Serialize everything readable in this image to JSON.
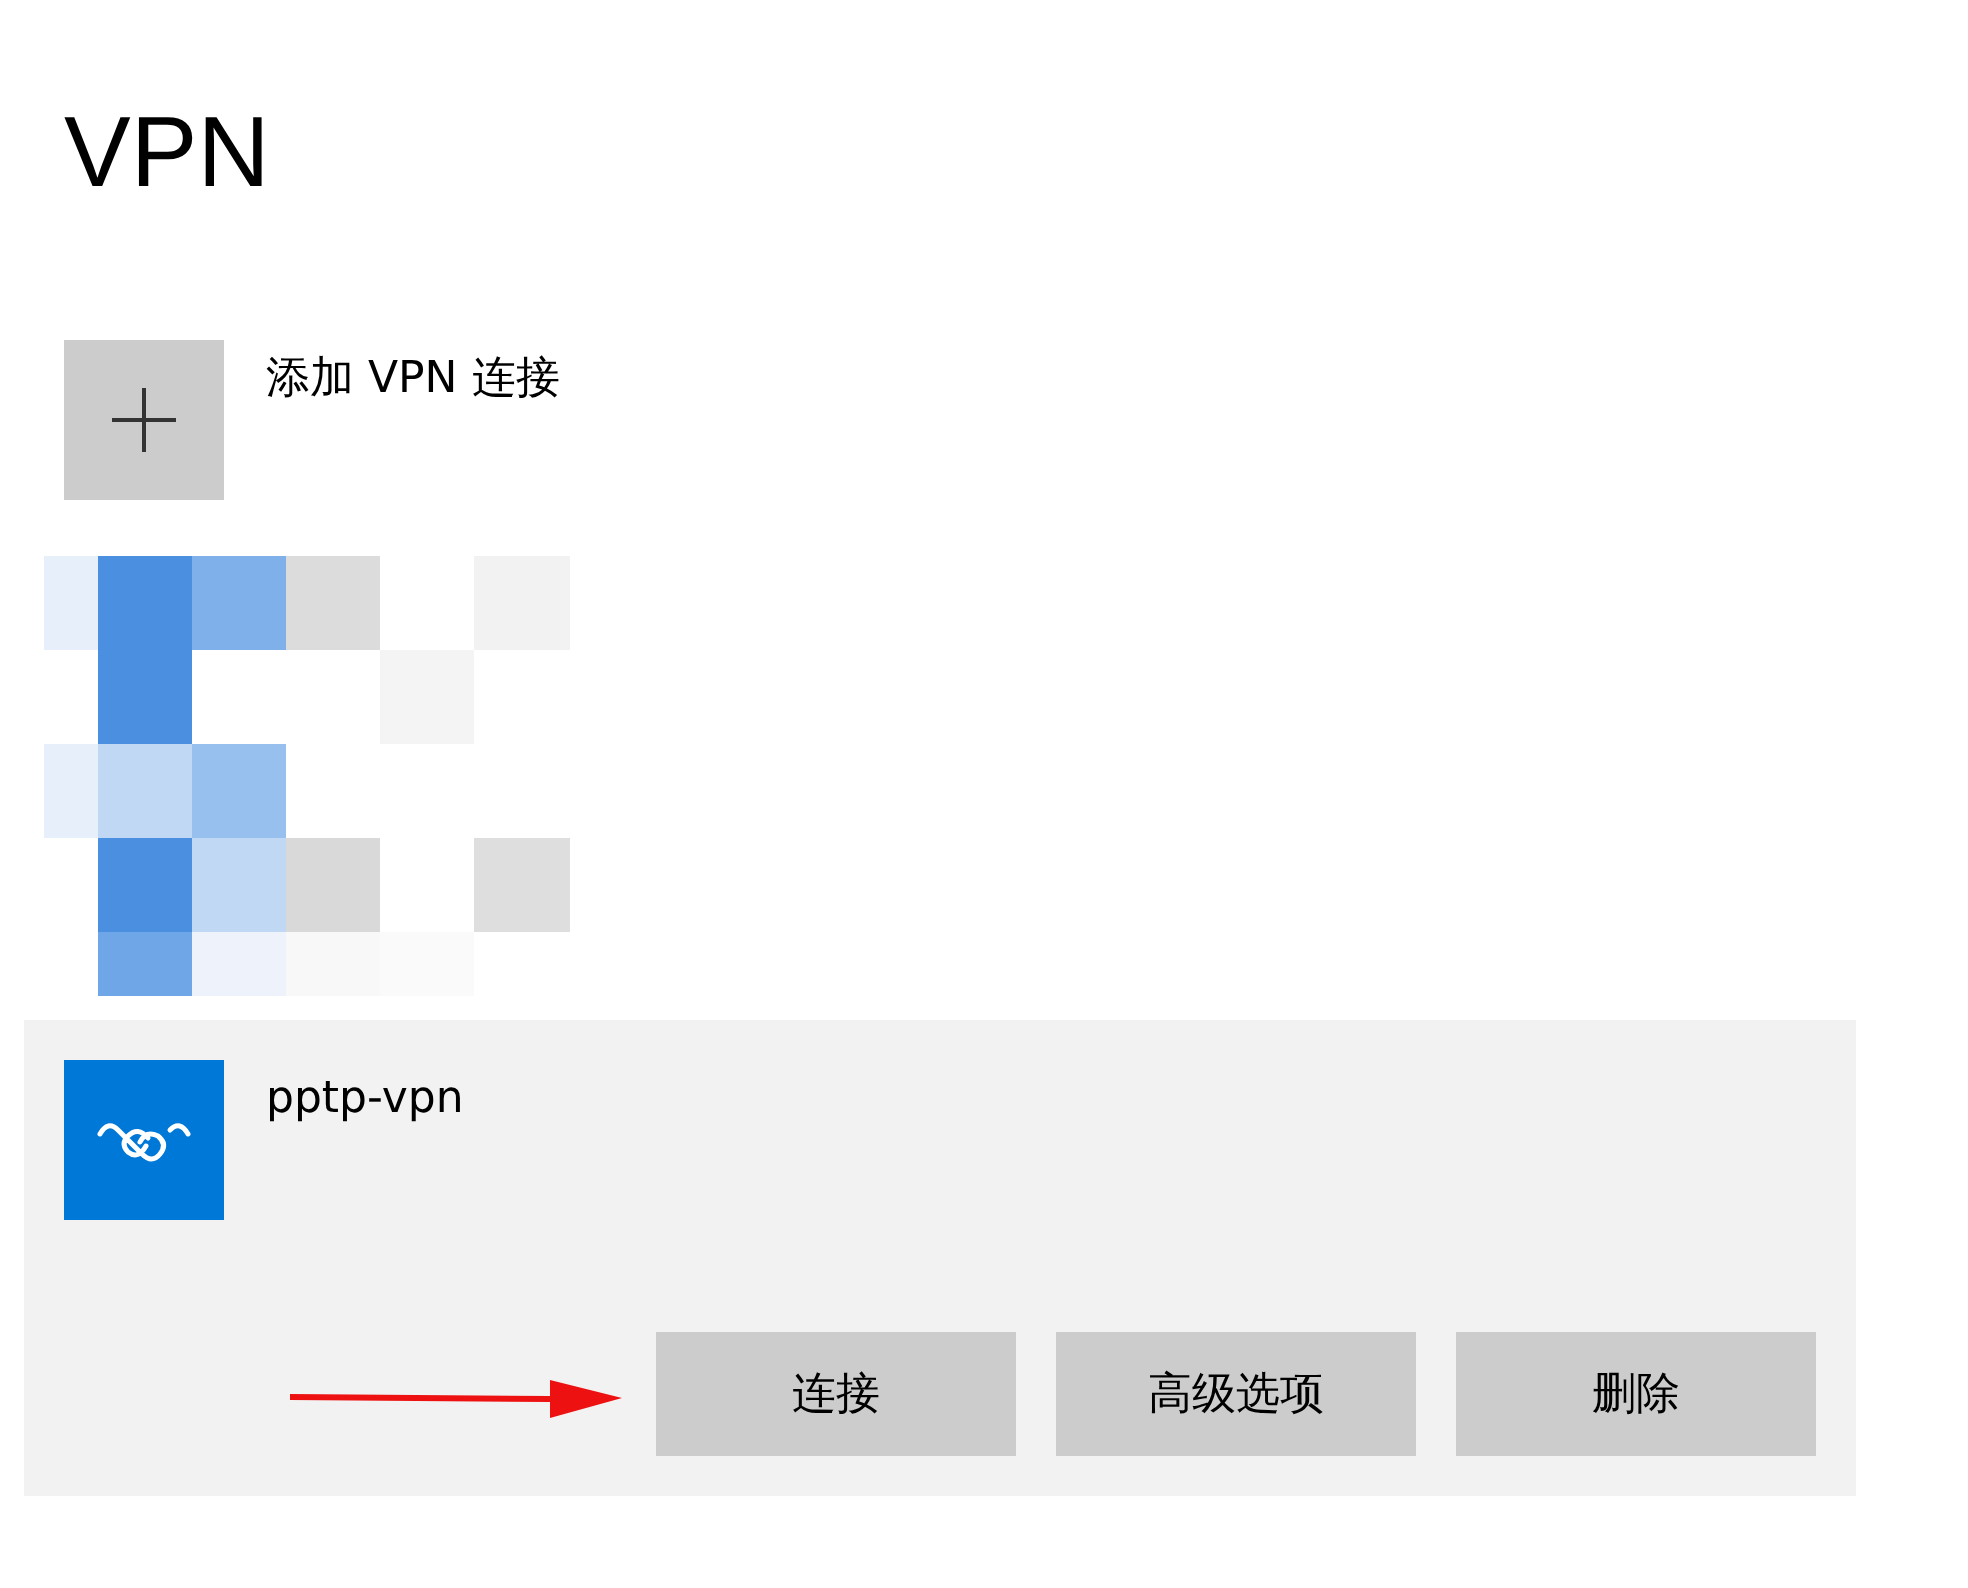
{
  "title": "VPN",
  "add_connection": {
    "label": "添加 VPN 连接"
  },
  "connections": [
    {
      "name": "pptp-vpn",
      "selected": true,
      "buttons": [
        "连接",
        "高级选项",
        "删除"
      ]
    }
  ]
}
